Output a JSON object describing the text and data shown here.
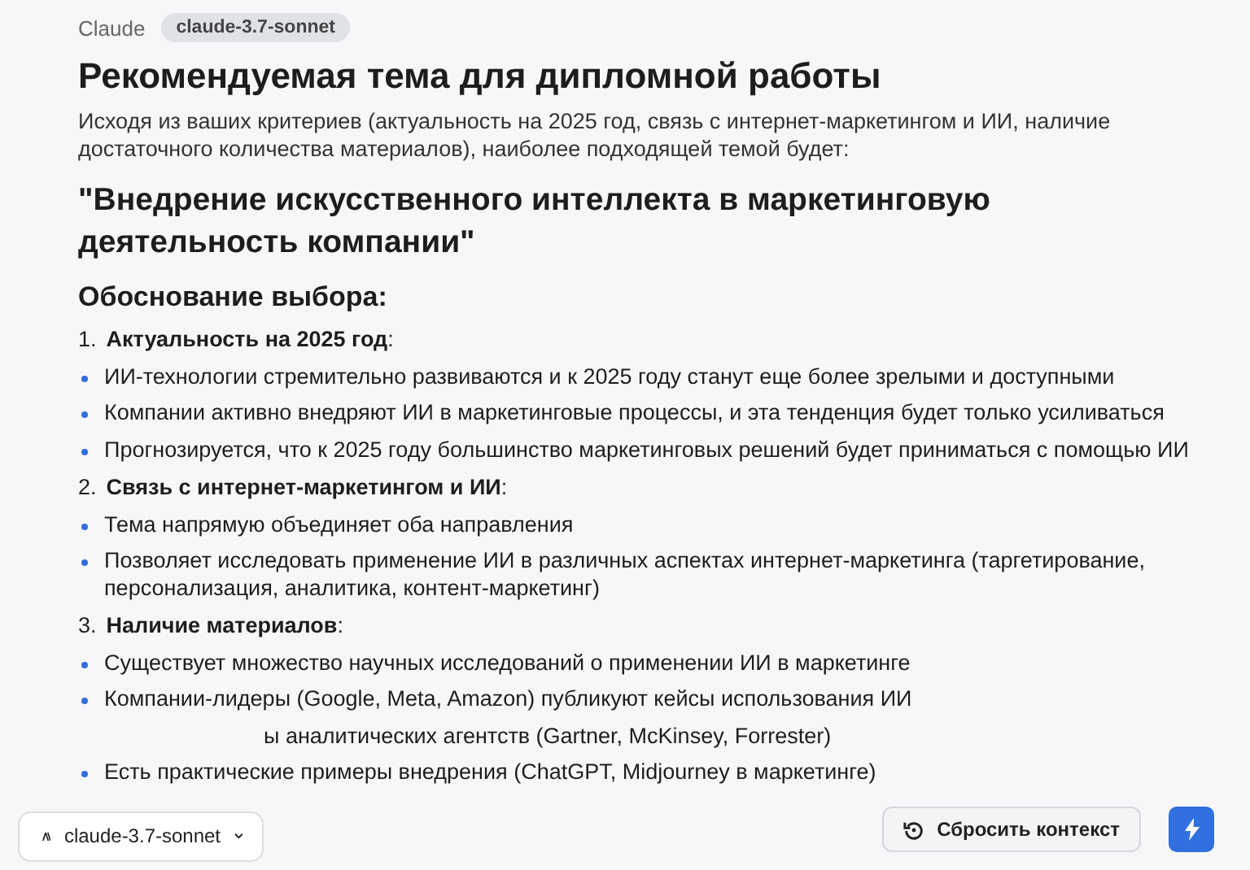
{
  "header": {
    "app": "Claude",
    "model_badge": "claude-3.7-sonnet"
  },
  "title": "Рекомендуемая тема для дипломной работы",
  "intro": "Исходя из ваших критериев (актуальность на 2025 год, связь с интернет-маркетингом и ИИ, наличие достаточного количества материалов), наиболее подходящей темой будет:",
  "topic": "\"Внедрение искусственного интеллекта в маркетинговую деятельность компании\"",
  "section_heading": "Обоснование выбора:",
  "sections": [
    {
      "number": "1.",
      "heading": "**Актуальность на 2025 год**:",
      "bullets": [
        {
          "kind": "item",
          "text": "ИИ-технологии стремительно развиваются и к 2025 году станут еще более зрелыми и доступными"
        },
        {
          "kind": "item",
          "text": "Компании активно внедряют ИИ в маркетинговые процессы, и эта тенденция будет только усиливаться"
        },
        {
          "kind": "item",
          "text": "Прогнозируется, что к 2025 году большинство маркетинговых решений будет приниматься с помощью ИИ"
        }
      ]
    },
    {
      "number": "2.",
      "heading": "**Связь с интернет-маркетингом и ИИ**:",
      "bullets": [
        {
          "kind": "item",
          "text": "Тема напрямую объединяет оба направления"
        },
        {
          "kind": "item",
          "text": "Позволяет исследовать применение ИИ в различных аспектах интернет-маркетинга (таргетирование, персонализация, аналитика, контент-маркетинг)"
        }
      ]
    },
    {
      "number": "3.",
      "heading": "**Наличие материалов**:",
      "bullets": [
        {
          "kind": "item",
          "text": "Существует множество научных исследований о применении ИИ в маркетинге"
        },
        {
          "kind": "item",
          "text": "Компании-лидеры (Google, Meta, Amazon) публикуют кейсы использования ИИ"
        },
        {
          "kind": "covered",
          "text": "ы аналитических агентств (Gartner, McKinsey, Forrester)"
        },
        {
          "kind": "item",
          "text": "Есть практические примеры внедрения (ChatGPT, Midjourney в маркетинге)"
        }
      ]
    }
  ],
  "footer": {
    "model_selector": "claude-3.7-sonnet",
    "reset_button": "Сбросить контекст"
  }
}
